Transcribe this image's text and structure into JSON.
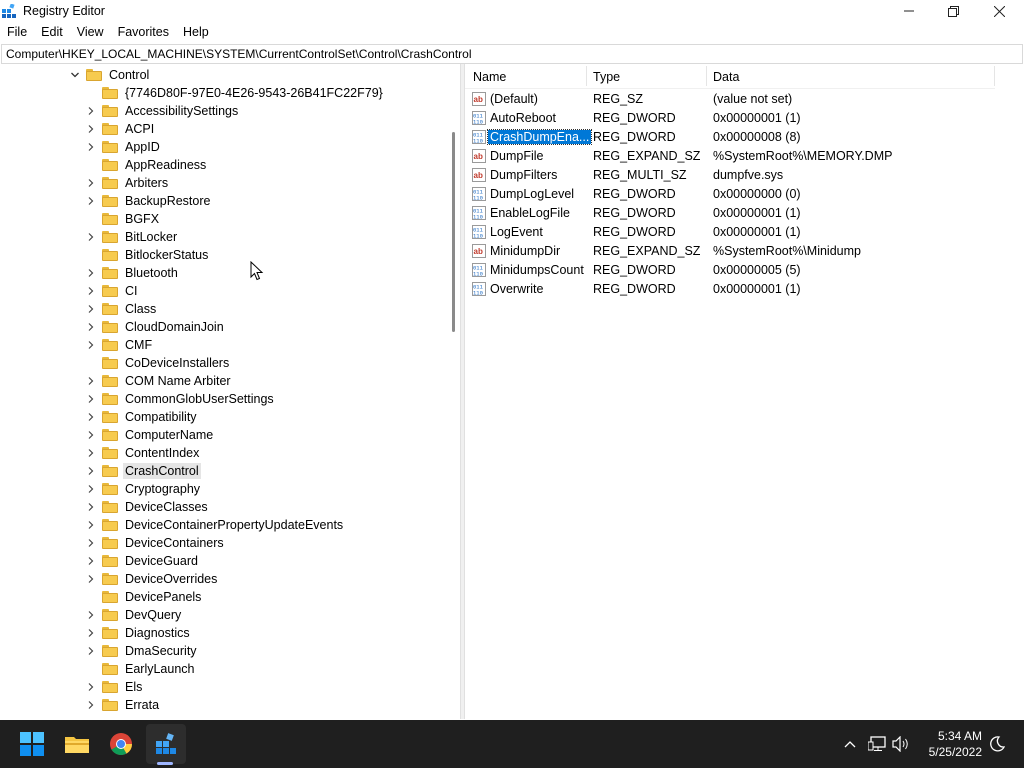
{
  "window": {
    "title": "Registry Editor"
  },
  "menu": [
    "File",
    "Edit",
    "View",
    "Favorites",
    "Help"
  ],
  "address": "Computer\\HKEY_LOCAL_MACHINE\\SYSTEM\\CurrentControlSet\\Control\\CrashControl",
  "tree": {
    "parent": "Control",
    "items": [
      {
        "label": "{7746D80F-97E0-4E26-9543-26B41FC22F79}",
        "expandable": false
      },
      {
        "label": "AccessibilitySettings",
        "expandable": true
      },
      {
        "label": "ACPI",
        "expandable": true
      },
      {
        "label": "AppID",
        "expandable": true
      },
      {
        "label": "AppReadiness",
        "expandable": false
      },
      {
        "label": "Arbiters",
        "expandable": true
      },
      {
        "label": "BackupRestore",
        "expandable": true
      },
      {
        "label": "BGFX",
        "expandable": false
      },
      {
        "label": "BitLocker",
        "expandable": true
      },
      {
        "label": "BitlockerStatus",
        "expandable": false
      },
      {
        "label": "Bluetooth",
        "expandable": true
      },
      {
        "label": "CI",
        "expandable": true
      },
      {
        "label": "Class",
        "expandable": true
      },
      {
        "label": "CloudDomainJoin",
        "expandable": true
      },
      {
        "label": "CMF",
        "expandable": true
      },
      {
        "label": "CoDeviceInstallers",
        "expandable": false
      },
      {
        "label": "COM Name Arbiter",
        "expandable": true
      },
      {
        "label": "CommonGlobUserSettings",
        "expandable": true
      },
      {
        "label": "Compatibility",
        "expandable": true
      },
      {
        "label": "ComputerName",
        "expandable": true
      },
      {
        "label": "ContentIndex",
        "expandable": true
      },
      {
        "label": "CrashControl",
        "expandable": true,
        "selected": true
      },
      {
        "label": "Cryptography",
        "expandable": true
      },
      {
        "label": "DeviceClasses",
        "expandable": true
      },
      {
        "label": "DeviceContainerPropertyUpdateEvents",
        "expandable": true
      },
      {
        "label": "DeviceContainers",
        "expandable": true
      },
      {
        "label": "DeviceGuard",
        "expandable": true
      },
      {
        "label": "DeviceOverrides",
        "expandable": true
      },
      {
        "label": "DevicePanels",
        "expandable": false
      },
      {
        "label": "DevQuery",
        "expandable": true
      },
      {
        "label": "Diagnostics",
        "expandable": true
      },
      {
        "label": "DmaSecurity",
        "expandable": true
      },
      {
        "label": "EarlyLaunch",
        "expandable": false
      },
      {
        "label": "Els",
        "expandable": true
      },
      {
        "label": "Errata",
        "expandable": true
      }
    ]
  },
  "values": {
    "headers": {
      "name": "Name",
      "type": "Type",
      "data": "Data"
    },
    "rows": [
      {
        "name": "(Default)",
        "type": "REG_SZ",
        "data": "(value not set)",
        "icon": "string-value-icon"
      },
      {
        "name": "AutoReboot",
        "type": "REG_DWORD",
        "data": "0x00000001 (1)",
        "icon": "binary-value-icon"
      },
      {
        "name": "CrashDumpEna...",
        "type": "REG_DWORD",
        "data": "0x00000008 (8)",
        "icon": "binary-value-icon",
        "selected": true
      },
      {
        "name": "DumpFile",
        "type": "REG_EXPAND_SZ",
        "data": "%SystemRoot%\\MEMORY.DMP",
        "icon": "string-value-icon"
      },
      {
        "name": "DumpFilters",
        "type": "REG_MULTI_SZ",
        "data": "dumpfve.sys",
        "icon": "string-value-icon"
      },
      {
        "name": "DumpLogLevel",
        "type": "REG_DWORD",
        "data": "0x00000000 (0)",
        "icon": "binary-value-icon"
      },
      {
        "name": "EnableLogFile",
        "type": "REG_DWORD",
        "data": "0x00000001 (1)",
        "icon": "binary-value-icon"
      },
      {
        "name": "LogEvent",
        "type": "REG_DWORD",
        "data": "0x00000001 (1)",
        "icon": "binary-value-icon"
      },
      {
        "name": "MinidumpDir",
        "type": "REG_EXPAND_SZ",
        "data": "%SystemRoot%\\Minidump",
        "icon": "string-value-icon"
      },
      {
        "name": "MinidumpsCount",
        "type": "REG_DWORD",
        "data": "0x00000005 (5)",
        "icon": "binary-value-icon"
      },
      {
        "name": "Overwrite",
        "type": "REG_DWORD",
        "data": "0x00000001 (1)",
        "icon": "binary-value-icon"
      }
    ]
  },
  "taskbar": {
    "apps": [
      "start-icon",
      "file-explorer-icon",
      "chrome-icon",
      "registry-editor-icon"
    ],
    "time": "5:34 AM",
    "date": "5/25/2022"
  },
  "colors": {
    "selection": "#0078d7",
    "taskbar": "#1f1f1f",
    "folder": "#f7cb4f"
  }
}
